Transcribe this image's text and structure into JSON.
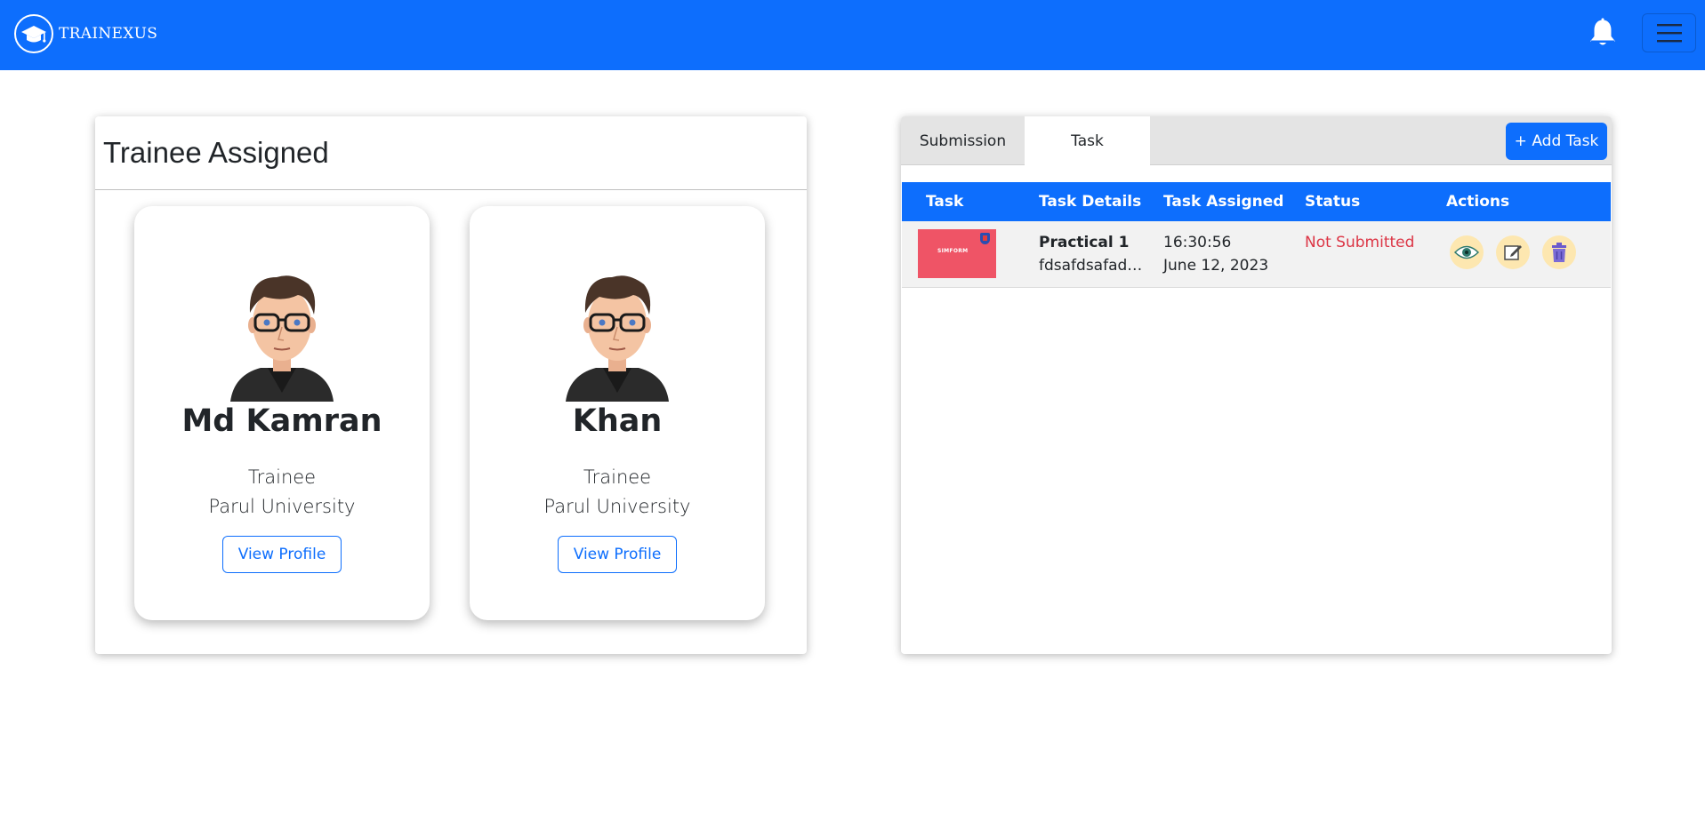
{
  "navbar": {
    "brand_name": "TRAINEXUS",
    "brand_icon": "graduation-cap-icon",
    "bell_icon": "bell-icon",
    "menu_icon": "hamburger-menu-icon",
    "color": "#0d6efd"
  },
  "trainees_panel": {
    "title": "Trainee Assigned",
    "trainees": [
      {
        "name": "Md Kamran",
        "role": "Trainee",
        "university": "Parul University",
        "button_label": "View Profile"
      },
      {
        "name": "Khan",
        "role": "Trainee",
        "university": "Parul University",
        "button_label": "View Profile"
      }
    ]
  },
  "tasks_panel": {
    "tabs": [
      {
        "label": "Submission",
        "active": false
      },
      {
        "label": "Task",
        "active": true
      }
    ],
    "add_button_label": "+ Add Task",
    "columns": [
      "Task",
      "Task Details",
      "Task Assigned",
      "Status",
      "Actions"
    ],
    "rows": [
      {
        "thumbnail_text": "SIMFORM",
        "title": "Practical 1",
        "details": "fdsafdsafads...",
        "time": "16:30:56",
        "date": "June 12, 2023",
        "status": "Not Submitted",
        "actions": [
          "eye-icon",
          "edit-icon",
          "trash-icon"
        ]
      }
    ]
  },
  "colors": {
    "primary": "#0d6efd",
    "danger": "#dc3545",
    "thumbnail": "#ef5466"
  }
}
